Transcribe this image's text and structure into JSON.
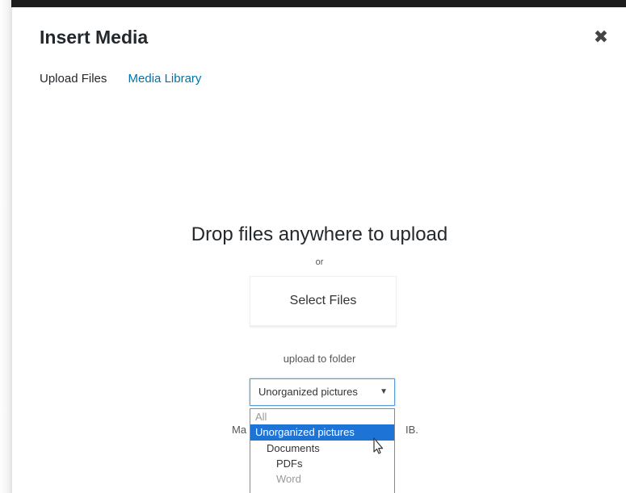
{
  "modal": {
    "title": "Insert Media",
    "close_icon": "close-icon"
  },
  "tabs": [
    {
      "label": "Upload Files",
      "active": true
    },
    {
      "label": "Media Library",
      "active": false
    }
  ],
  "upload": {
    "drop_title": "Drop files anywhere to upload",
    "or_text": "or",
    "select_files_label": "Select Files",
    "folder_label": "upload to folder",
    "folder_selected": "Unorganized pictures",
    "max_prefix": "Ma",
    "max_suffix": "IB."
  },
  "folder_dropdown": {
    "options": [
      {
        "label": "All",
        "level": 0,
        "state": "faded"
      },
      {
        "label": "Unorganized pictures",
        "level": 0,
        "state": "highlighted"
      },
      {
        "label": "Documents",
        "level": 1,
        "state": "normal"
      },
      {
        "label": "PDFs",
        "level": 2,
        "state": "normal"
      },
      {
        "label": "Word",
        "level": 2,
        "state": "normal"
      }
    ]
  },
  "colors": {
    "link": "#0073aa",
    "highlight": "#1e73d6",
    "focus_border": "#5b9dd9"
  }
}
